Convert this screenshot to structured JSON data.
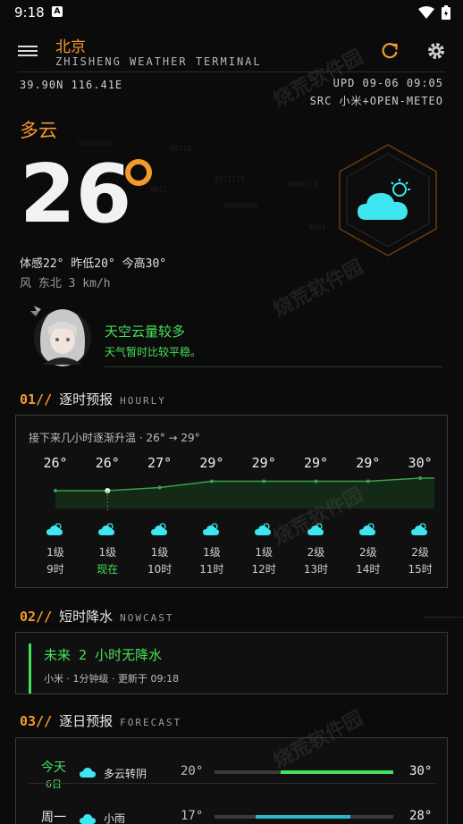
{
  "status_bar": {
    "time": "9:18",
    "a_badge": "A"
  },
  "header": {
    "city": "北京",
    "subtitle": "ZHISHENG WEATHER TERMINAL",
    "coords": "39.90N  116.41E",
    "update": "UPD 09-06 09:05",
    "source": "SRC 小米+OPEN-METEO"
  },
  "current": {
    "condition": "多云",
    "temp": "26",
    "feels_line": "体感22°  昨低20° 今高30°",
    "wind_line": "风 东北 3 km/h"
  },
  "tip": {
    "title": "天空云量较多",
    "subtitle": "天气暂时比较平稳。"
  },
  "hourly": {
    "num": "01//",
    "title": "逐时预报",
    "en": "HOURLY",
    "note": "接下来几小时逐渐升温 · 26° → 29°",
    "items": [
      {
        "temp": "26°",
        "value": 26,
        "level": "1级",
        "label": "9时",
        "now": false
      },
      {
        "temp": "26°",
        "value": 26,
        "level": "1级",
        "label": "现在",
        "now": true
      },
      {
        "temp": "27°",
        "value": 27,
        "level": "1级",
        "label": "10时",
        "now": false
      },
      {
        "temp": "29°",
        "value": 29,
        "level": "1级",
        "label": "11时",
        "now": false
      },
      {
        "temp": "29°",
        "value": 29,
        "level": "1级",
        "label": "12时",
        "now": false
      },
      {
        "temp": "29°",
        "value": 29,
        "level": "2级",
        "label": "13时",
        "now": false
      },
      {
        "temp": "29°",
        "value": 29,
        "level": "2级",
        "label": "14时",
        "now": false
      },
      {
        "temp": "30°",
        "value": 30,
        "level": "2级",
        "label": "15时",
        "now": false
      }
    ]
  },
  "nowcast": {
    "num": "02//",
    "title": "短时降水",
    "en": "NOWCAST",
    "headline": "未来 2 小时无降水",
    "detail": "小米 · 1分钟级 · 更新于 09:18"
  },
  "forecast": {
    "num": "03//",
    "title": "逐日预报",
    "en": "FORECAST",
    "days": [
      {
        "name": "今天",
        "date": "6日",
        "desc": "多云转阴",
        "lo": "20°",
        "hi": "30°",
        "range": [
          0.37,
          1.0
        ],
        "color": "#47e05a",
        "highlight": true
      },
      {
        "name": "周一",
        "date": "",
        "desc": "小雨",
        "lo": "17°",
        "hi": "28°",
        "range": [
          0.23,
          0.76
        ],
        "color": "#2bb7c9",
        "highlight": false
      }
    ]
  },
  "colors": {
    "accent": "#f39a2c",
    "green": "#47e05a",
    "cyan": "#3ee6f0"
  },
  "icons": [
    "menu-icon",
    "refresh-icon",
    "gear-icon",
    "cloud-sun-icon",
    "wifi-icon",
    "battery-icon"
  ]
}
